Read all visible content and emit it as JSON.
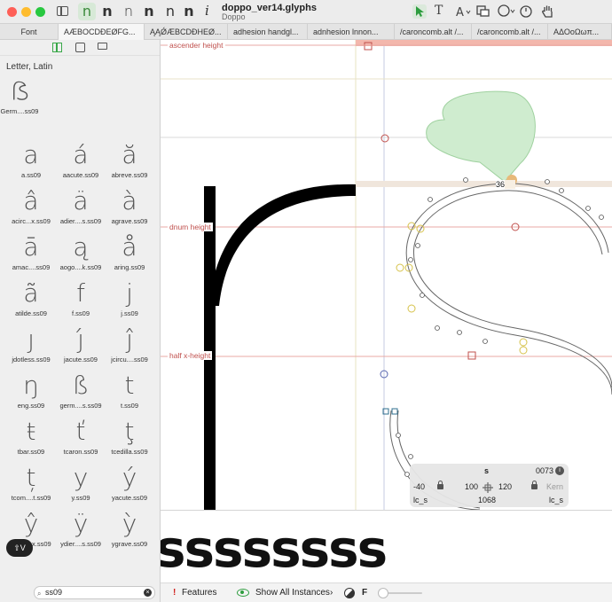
{
  "window": {
    "doc_title": "doppo_ver14.glyphs",
    "doc_subtitle": "Doppo"
  },
  "toolbar": {
    "weight_glyphs": [
      "n",
      "n",
      "n",
      "n",
      "n",
      "n"
    ],
    "info_glyph": "i"
  },
  "tabs": [
    {
      "label": "Font",
      "active": false
    },
    {
      "label": "AÆBOCDÐEØFG...",
      "active": true
    },
    {
      "label": "ĄĄǾÆBCDÐHEØ...",
      "active": false
    },
    {
      "label": "adhesion handgl...",
      "active": false
    },
    {
      "label": "adnhesion lnnon...",
      "active": false
    },
    {
      "label": "/caroncomb.alt /...",
      "active": false
    },
    {
      "label": "/caroncomb.alt /...",
      "active": false
    },
    {
      "label": "AΔΟοΩωπ...",
      "active": false
    }
  ],
  "sidebar": {
    "category": "Letter, Latin",
    "glyphs": [
      {
        "char": "ẞ",
        "name": "Germ....ss09"
      },
      {
        "char": "a",
        "name": "a.ss09"
      },
      {
        "char": "á",
        "name": "aacute.ss09"
      },
      {
        "char": "ă",
        "name": "abreve.ss09"
      },
      {
        "char": "â",
        "name": "acirc...x.ss09"
      },
      {
        "char": "ä",
        "name": "adier....s.ss09"
      },
      {
        "char": "à",
        "name": "agrave.ss09"
      },
      {
        "char": "ā",
        "name": "amac....ss09"
      },
      {
        "char": "ą",
        "name": "aogo....k.ss09"
      },
      {
        "char": "å",
        "name": "aring.ss09"
      },
      {
        "char": "ã",
        "name": "atilde.ss09"
      },
      {
        "char": "f",
        "name": "f.ss09"
      },
      {
        "char": "j",
        "name": "j.ss09"
      },
      {
        "char": "ȷ",
        "name": "jdotless.ss09"
      },
      {
        "char": "ȷ́",
        "name": "jacute.ss09"
      },
      {
        "char": "ĵ",
        "name": "jcircu....ss09"
      },
      {
        "char": "ŋ",
        "name": "eng.ss09"
      },
      {
        "char": "ß",
        "name": "germ....s.ss09"
      },
      {
        "char": "t",
        "name": "t.ss09"
      },
      {
        "char": "ŧ",
        "name": "tbar.ss09"
      },
      {
        "char": "ť",
        "name": "tcaron.ss09"
      },
      {
        "char": "ţ",
        "name": "tcedilla.ss09"
      },
      {
        "char": "ț",
        "name": "tcom....t.ss09"
      },
      {
        "char": "y",
        "name": "y.ss09"
      },
      {
        "char": "ý",
        "name": "yacute.ss09"
      },
      {
        "char": "ŷ",
        "name": "ycirc....x.ss09"
      },
      {
        "char": "ÿ",
        "name": "ydier....s.ss09"
      },
      {
        "char": "ỳ",
        "name": "ygrave.ss09"
      }
    ],
    "search_value": "ss09",
    "shortcut_label": "⇧V"
  },
  "canvas": {
    "metrics": [
      "ascender height",
      "dnum height",
      "half x-height"
    ],
    "badge": "36"
  },
  "info_panel": {
    "glyph": "s",
    "unicode": "0073",
    "lsb": "-40",
    "width": "100",
    "rsb": "120",
    "kern": "Kern",
    "left_group": "lc_s",
    "advance": "1068",
    "right_group": "lc_s"
  },
  "preview": {
    "text": "ssssssss"
  },
  "bottom": {
    "features": "Features",
    "instances": "Show All Instances",
    "instances_chevron": "›",
    "f_label": "F"
  },
  "colors": {
    "metric_red": "#c0504d",
    "accent_green": "#2e9d3f",
    "selection_fill": "#cfeccf"
  }
}
